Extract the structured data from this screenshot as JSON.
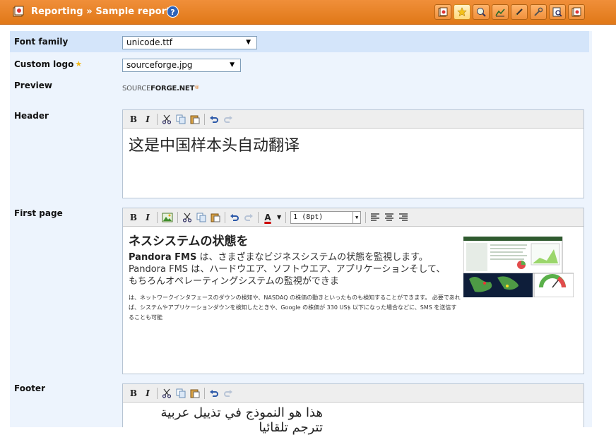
{
  "header": {
    "title": "Reporting » Sample report",
    "help_icon": "help-icon",
    "tabs": [
      {
        "icon": "report-icon"
      },
      {
        "icon": "star-icon",
        "active": true
      },
      {
        "icon": "view-icon"
      },
      {
        "icon": "chart-icon"
      },
      {
        "icon": "pencil-icon"
      },
      {
        "icon": "wrench-icon"
      },
      {
        "icon": "search-list-icon"
      },
      {
        "icon": "report-list-icon"
      }
    ]
  },
  "form": {
    "font_family": {
      "label": "Font family",
      "value": "unicode.ttf"
    },
    "custom_logo": {
      "label": "Custom logo",
      "value": "sourceforge.jpg"
    },
    "preview": {
      "label": "Preview",
      "logo_text_1": "SOURCE",
      "logo_text_2": "FORGE.NET",
      "logo_mark": "®"
    },
    "header_field": {
      "label": "Header",
      "content": "这是中国样本头自动翻译"
    },
    "first_page": {
      "label": "First page",
      "font_size": "1 (8pt)",
      "title": "ネスシステムの状態を",
      "para_bold": "Pandora FMS",
      "para": " は、さまざまなビジネスシステムの状態を監視します。Pandora FMS は、ハードウエア、ソフトウエア、アプリケーションそして、もちろんオペレーティングシステムの監視ができま",
      "small": "は、ネットワークインタフェースのダウンの検知や、NASDAQ の株価の動きといったものも検知することができます。 必要であれば、システムやアプリケーションダウンを検知したときや、Google の株価が 330 US$ 以下になった場合などに、SMS を送信することも可能"
    },
    "footer_field": {
      "label": "Footer",
      "content": "هذا هو النموذج في تذييل عربية تترجم تلقائيا"
    }
  },
  "toolbar": {
    "bold": "B",
    "italic": "I",
    "font_color": "A"
  }
}
